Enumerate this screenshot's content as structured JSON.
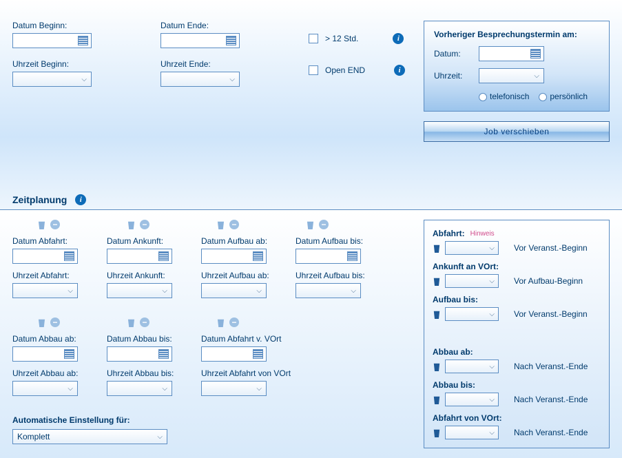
{
  "labels": {
    "datumBeginn": "Datum Beginn:",
    "datumEnde": "Datum Ende:",
    "uhrzeitBeginn": "Uhrzeit Beginn:",
    "uhrzeitEnde": "Uhrzeit Ende:",
    "gt12": "> 12 Std.",
    "openEnd": "Open END"
  },
  "meeting": {
    "title": "Vorheriger Besprechungstermin am:",
    "datum": "Datum:",
    "uhrzeit": "Uhrzeit:",
    "telefonisch": "telefonisch",
    "persoenlich": "persönlich"
  },
  "jobBtn": "Job verschieben",
  "sectionTitle": "Zeitplanung",
  "fields": {
    "datumAbfahrt": "Datum Abfahrt:",
    "datumAnkunft": "Datum Ankunft:",
    "datumAufbauAb": "Datum Aufbau ab:",
    "datumAufbauBis": "Datum Aufbau bis:",
    "uhrzeitAbfahrt": "Uhrzeit Abfahrt:",
    "uhrzeitAnkunft": "Uhrzeit Ankunft:",
    "uhrzeitAufbauAb": "Uhrzeit Aufbau ab:",
    "uhrzeitAufbauBis": "Uhrzeit Aufbau bis:",
    "datumAbbauAb": "Datum Abbau ab:",
    "datumAbbauBis": "Datum Abbau bis:",
    "datumAbfahrtVort": "Datum Abfahrt v. VOrt",
    "uhrzeitAbbauAb": "Uhrzeit Abbau ab:",
    "uhrzeitAbbauBis": "Uhrzeit Abbau bis:",
    "uhrzeitAbfahrtVort": "Uhrzeit Abfahrt von VOrt"
  },
  "autoLabel": "Automatische Einstellung für:",
  "autoValue": "Komplett",
  "offsets": {
    "abfahrt": "Abfahrt:",
    "hinweis": "Hinweis",
    "ankunft": "Ankunft an VOrt:",
    "aufbauBis": "Aufbau bis:",
    "abbauAb": "Abbau ab:",
    "abbauBis": "Abbau bis:",
    "abfahrtVort": "Abfahrt von VOrt:",
    "vorBeginn": "Vor Veranst.-Beginn",
    "vorAufbau": "Vor Aufbau-Beginn",
    "nachEnde": "Nach Veranst.-Ende"
  }
}
